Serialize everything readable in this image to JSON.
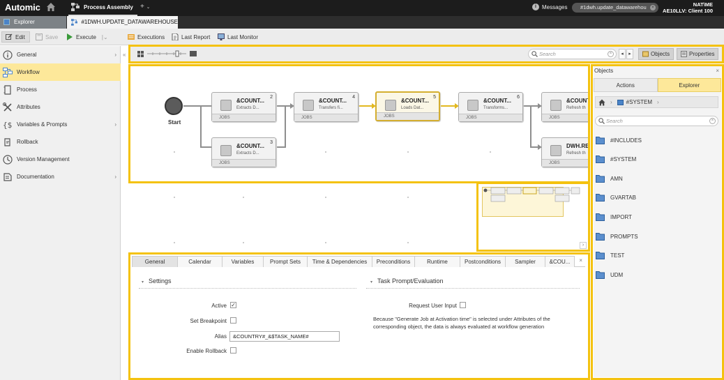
{
  "topbar": {
    "brand": "Automic",
    "app_tab": "Process Assembly",
    "add_tab": "+",
    "messages_label": "Messages",
    "object_pill": "#1dwh.update_datawarehou",
    "user_line1": "NAT\\ME",
    "user_line2": "AE10LLV: Client 100"
  },
  "doc_tabs": {
    "explorer": "Explorer",
    "active_doc": "#1DWH.UPDATE_DATAWAREHOUSE"
  },
  "toolbar": {
    "edit": "Edit",
    "save": "Save",
    "execute": "Execute",
    "executions": "Executions",
    "last_report": "Last Report",
    "last_monitor": "Last Monitor"
  },
  "leftnav": {
    "items": [
      {
        "label": "General",
        "has_submenu": true
      },
      {
        "label": "Workflow",
        "has_submenu": false,
        "active": true
      },
      {
        "label": "Process",
        "has_submenu": false
      },
      {
        "label": "Attributes",
        "has_submenu": false
      },
      {
        "label": "Variables & Prompts",
        "has_submenu": true
      },
      {
        "label": "Rollback",
        "has_submenu": false
      },
      {
        "label": "Version Management",
        "has_submenu": false
      },
      {
        "label": "Documentation",
        "has_submenu": true
      }
    ]
  },
  "canvas_toolbar": {
    "search_placeholder": "Search",
    "objects_label": "Objects",
    "properties_label": "Properties"
  },
  "workflow": {
    "start_label": "Start",
    "nodes": [
      {
        "name": "&COUNT...",
        "desc": "Extracts D...",
        "num": "2",
        "type": "JOBS"
      },
      {
        "name": "&COUNT...",
        "desc": "Extracts D...",
        "num": "3",
        "type": "JOBS"
      },
      {
        "name": "&COUNT...",
        "desc": "Transfers fi...",
        "num": "4",
        "type": "JOBS"
      },
      {
        "name": "&COUNT...",
        "desc": "Loads Dat...",
        "num": "5",
        "type": "JOBS",
        "selected": true
      },
      {
        "name": "&COUNT...",
        "desc": "Transforms...",
        "num": "6",
        "type": "JOBS"
      },
      {
        "name": "&COUNT",
        "desc": "Refresh th",
        "num": "",
        "type": "JOBS"
      },
      {
        "name": "DWH.RE",
        "desc": "Refresh th",
        "num": "",
        "type": "JOBS"
      }
    ]
  },
  "props": {
    "tabs": [
      "General",
      "Calendar",
      "Variables",
      "Prompt Sets",
      "Time & Dependencies",
      "Preconditions",
      "Runtime",
      "Postconditions",
      "Sampler",
      "&COU..."
    ],
    "settings_title": "Settings",
    "task_prompt_title": "Task Prompt/Evaluation",
    "active_label": "Active",
    "active_checked": true,
    "breakpoint_label": "Set Breakpoint",
    "alias_label": "Alias",
    "alias_value": "&COUNTRY#_&$TASK_NAME#",
    "rollback_label": "Enable Rollback",
    "request_label": "Request User Input",
    "note": "Because \"Generate Job at Activation time\" is selected under Attributes of the corresponding object, the data is always evaluated at workflow generation"
  },
  "objects_panel": {
    "title": "Objects",
    "tab_actions": "Actions",
    "tab_explorer": "Explorer",
    "crumb": "#SYSTEM",
    "search_placeholder": "Search",
    "folders": [
      "#INCLUDES",
      "#SYSTEM",
      "AMN",
      "GVARTAB",
      "IMPORT",
      "PROMPTS",
      "TEST",
      "UDM"
    ]
  },
  "colors": {
    "highlight": "#f4c20f",
    "active_nav": "#fde89a",
    "topbar": "#1c1c1c",
    "edge_gray": "#8e8e8e",
    "edge_yellow": "#e2b820"
  }
}
